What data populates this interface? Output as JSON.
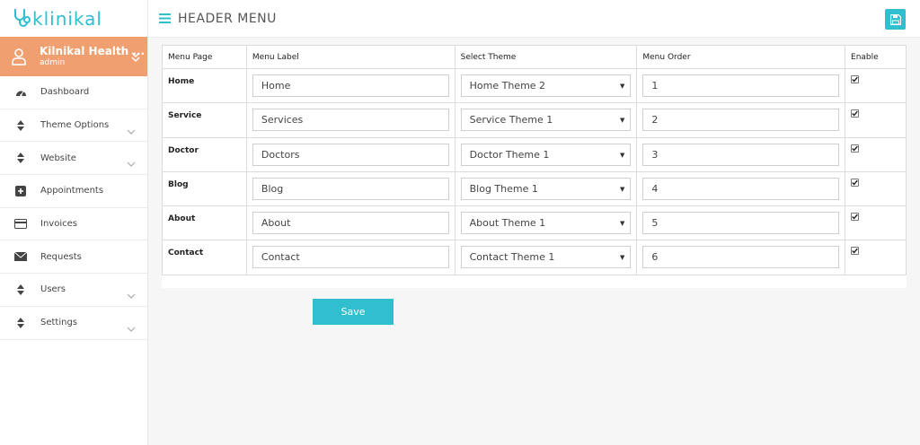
{
  "brand": {
    "logo_text": "klinikal",
    "accent": "#2fbfcf"
  },
  "user": {
    "name": "Kilnikal Health ...",
    "role": "admin",
    "bg": "#f0a070"
  },
  "sidebar": {
    "items": [
      {
        "label": "Dashboard",
        "icon": "dashboard-icon"
      },
      {
        "label": "Theme Options",
        "icon": "sort-icon",
        "chevron": true
      },
      {
        "label": "Website",
        "icon": "sort-icon",
        "chevron": true
      },
      {
        "label": "Appointments",
        "icon": "plus-square-icon"
      },
      {
        "label": "Invoices",
        "icon": "credit-card-icon"
      },
      {
        "label": "Requests",
        "icon": "envelope-icon"
      },
      {
        "label": "Users",
        "icon": "sort-icon",
        "chevron": true
      },
      {
        "label": "Settings",
        "icon": "sort-icon",
        "chevron": true
      }
    ]
  },
  "header": {
    "title": "HEADER MENU"
  },
  "table": {
    "columns": [
      "Menu Page",
      "Menu Label",
      "Select Theme",
      "Menu Order",
      "Enable"
    ],
    "rows": [
      {
        "page": "Home",
        "label": "Home",
        "theme": "Home Theme 2",
        "order": "1",
        "enabled": true
      },
      {
        "page": "Service",
        "label": "Services",
        "theme": "Service Theme 1",
        "order": "2",
        "enabled": true
      },
      {
        "page": "Doctor",
        "label": "Doctors",
        "theme": "Doctor Theme 1",
        "order": "3",
        "enabled": true
      },
      {
        "page": "Blog",
        "label": "Blog",
        "theme": "Blog Theme 1",
        "order": "4",
        "enabled": true
      },
      {
        "page": "About",
        "label": "About",
        "theme": "About Theme 1",
        "order": "5",
        "enabled": true
      },
      {
        "page": "Contact",
        "label": "Contact",
        "theme": "Contact Theme 1",
        "order": "6",
        "enabled": true
      }
    ]
  },
  "actions": {
    "save_label": "Save"
  }
}
